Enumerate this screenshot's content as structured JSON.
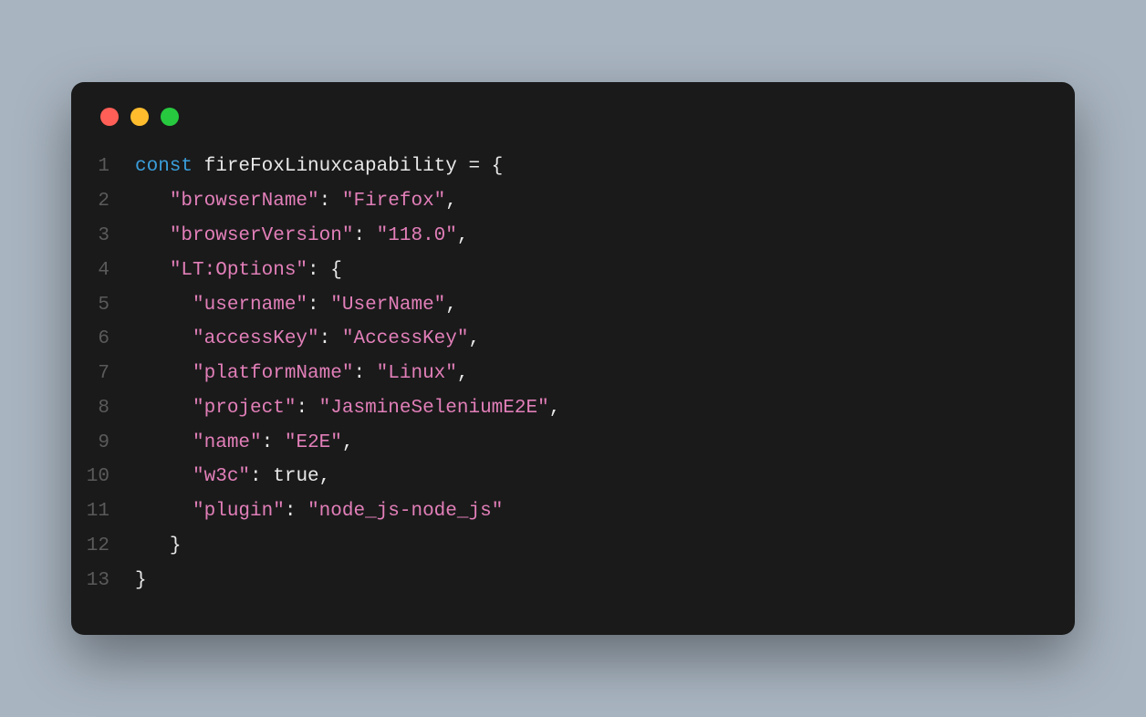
{
  "traffic_lights": {
    "red": "#ff5f56",
    "yellow": "#ffbd2e",
    "green": "#27c93f"
  },
  "code": {
    "lines": [
      {
        "num": "1",
        "indent": "",
        "tokens": [
          {
            "cls": "kw",
            "text": "const"
          },
          {
            "cls": "punct",
            "text": " "
          },
          {
            "cls": "ident",
            "text": "fireFoxLinuxcapability"
          },
          {
            "cls": "punct",
            "text": " = {"
          }
        ]
      },
      {
        "num": "2",
        "indent": "   ",
        "tokens": [
          {
            "cls": "str",
            "text": "\"browserName\""
          },
          {
            "cls": "punct",
            "text": ": "
          },
          {
            "cls": "str",
            "text": "\"Firefox\""
          },
          {
            "cls": "punct",
            "text": ","
          }
        ]
      },
      {
        "num": "3",
        "indent": "   ",
        "tokens": [
          {
            "cls": "str",
            "text": "\"browserVersion\""
          },
          {
            "cls": "punct",
            "text": ": "
          },
          {
            "cls": "str",
            "text": "\"118.0\""
          },
          {
            "cls": "punct",
            "text": ","
          }
        ]
      },
      {
        "num": "4",
        "indent": "   ",
        "tokens": [
          {
            "cls": "str",
            "text": "\"LT:Options\""
          },
          {
            "cls": "punct",
            "text": ": {"
          }
        ]
      },
      {
        "num": "5",
        "indent": "     ",
        "tokens": [
          {
            "cls": "str",
            "text": "\"username\""
          },
          {
            "cls": "punct",
            "text": ": "
          },
          {
            "cls": "str",
            "text": "\"UserName\""
          },
          {
            "cls": "punct",
            "text": ","
          }
        ]
      },
      {
        "num": "6",
        "indent": "     ",
        "tokens": [
          {
            "cls": "str",
            "text": "\"accessKey\""
          },
          {
            "cls": "punct",
            "text": ": "
          },
          {
            "cls": "str",
            "text": "\"AccessKey\""
          },
          {
            "cls": "punct",
            "text": ","
          }
        ]
      },
      {
        "num": "7",
        "indent": "     ",
        "tokens": [
          {
            "cls": "str",
            "text": "\"platformName\""
          },
          {
            "cls": "punct",
            "text": ": "
          },
          {
            "cls": "str",
            "text": "\"Linux\""
          },
          {
            "cls": "punct",
            "text": ","
          }
        ]
      },
      {
        "num": "8",
        "indent": "     ",
        "tokens": [
          {
            "cls": "str",
            "text": "\"project\""
          },
          {
            "cls": "punct",
            "text": ": "
          },
          {
            "cls": "str",
            "text": "\"JasmineSeleniumE2E\""
          },
          {
            "cls": "punct",
            "text": ","
          }
        ]
      },
      {
        "num": "9",
        "indent": "     ",
        "tokens": [
          {
            "cls": "str",
            "text": "\"name\""
          },
          {
            "cls": "punct",
            "text": ": "
          },
          {
            "cls": "str",
            "text": "\"E2E\""
          },
          {
            "cls": "punct",
            "text": ","
          }
        ]
      },
      {
        "num": "10",
        "indent": "     ",
        "tokens": [
          {
            "cls": "str",
            "text": "\"w3c\""
          },
          {
            "cls": "punct",
            "text": ": "
          },
          {
            "cls": "bool",
            "text": "true"
          },
          {
            "cls": "punct",
            "text": ","
          }
        ]
      },
      {
        "num": "11",
        "indent": "     ",
        "tokens": [
          {
            "cls": "str",
            "text": "\"plugin\""
          },
          {
            "cls": "punct",
            "text": ": "
          },
          {
            "cls": "str",
            "text": "\"node_js-node_js\""
          }
        ]
      },
      {
        "num": "12",
        "indent": "   ",
        "tokens": [
          {
            "cls": "punct",
            "text": "}"
          }
        ]
      },
      {
        "num": "13",
        "indent": "",
        "tokens": [
          {
            "cls": "punct",
            "text": "}"
          }
        ]
      }
    ]
  }
}
